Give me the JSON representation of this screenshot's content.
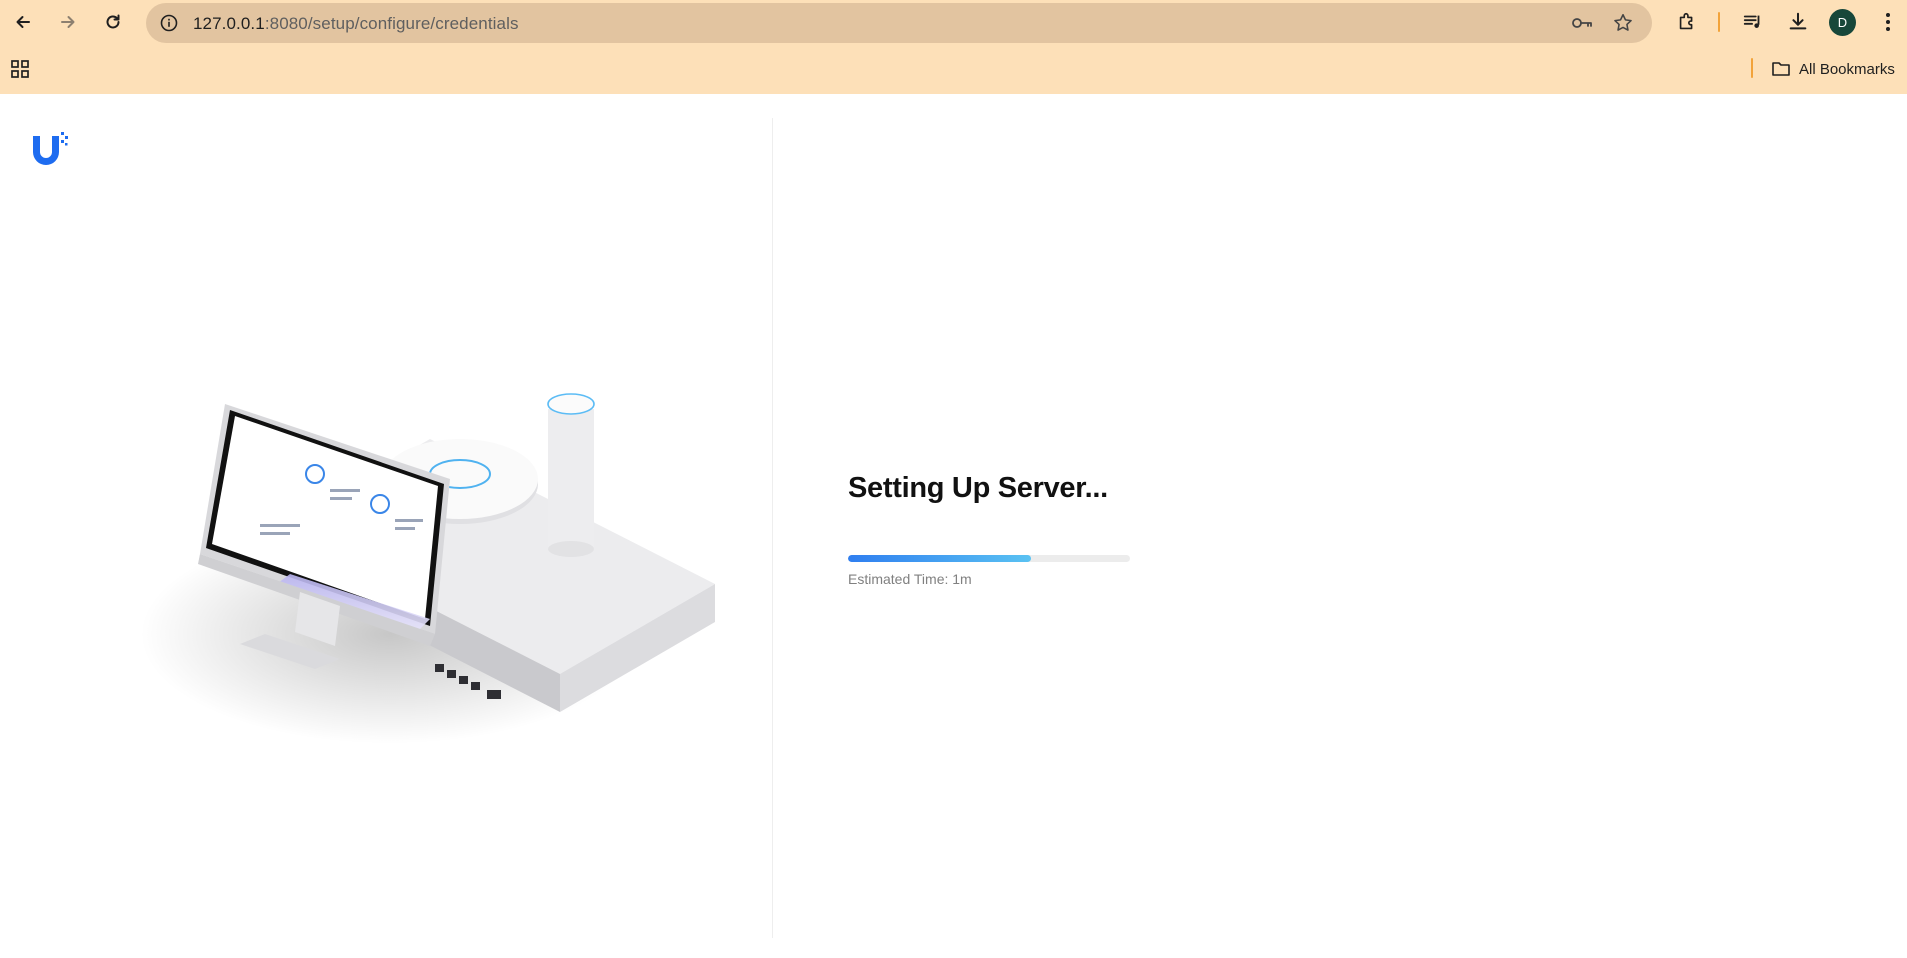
{
  "browser": {
    "url_host": "127.0.0.1",
    "url_path": ":8080/setup/configure/credentials",
    "profile_initial": "D",
    "bookmarks_label": "All Bookmarks",
    "icons": {
      "back": "back-arrow-icon",
      "forward": "forward-arrow-icon",
      "reload": "reload-icon",
      "site_info": "site-info-icon",
      "password": "key-icon",
      "bookmark_star": "star-icon",
      "extensions": "puzzle-icon",
      "media": "media-queue-icon",
      "downloads": "download-icon",
      "menu": "kebab-menu-icon",
      "apps": "apps-grid-icon",
      "folder": "folder-icon"
    },
    "colors": {
      "toolbar_bg": "#fde0b8",
      "omnibox_bg": "#e2c4a0",
      "avatar_bg": "#17473a"
    }
  },
  "app": {
    "logo": "ubiquiti-u-logo",
    "title": "Setting Up Server...",
    "progress": {
      "fraction": 0.65
    },
    "estimated_time": "Estimated Time: 1m",
    "colors": {
      "accent_start": "#2f7ef0",
      "accent_end": "#5ac2f2",
      "logo": "#1e6cf0"
    }
  }
}
